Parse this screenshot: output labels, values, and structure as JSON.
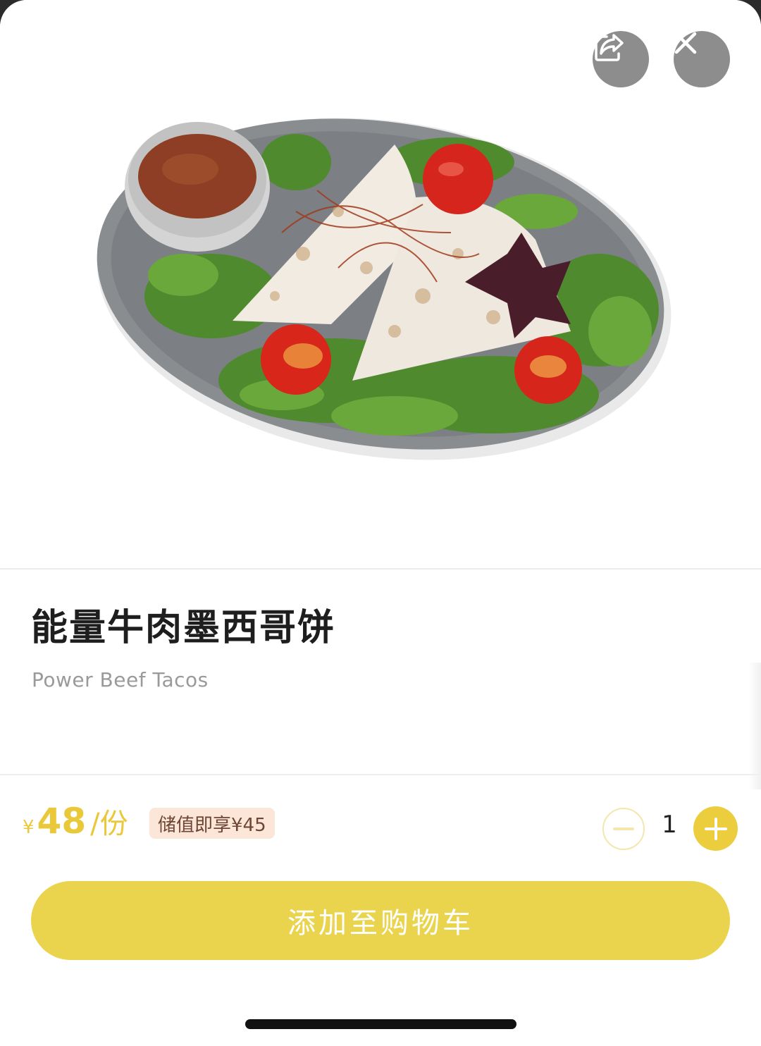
{
  "product": {
    "image_icon": "quesadilla-plate-photo",
    "name_cn": "能量牛肉墨西哥饼",
    "name_en": "Power Beef Tacos"
  },
  "header": {
    "share_icon": "share-icon",
    "close_icon": "close-icon"
  },
  "pricing": {
    "currency_symbol": "¥",
    "price": "48",
    "unit": "/份",
    "member_badge": "储值即享¥45",
    "price_color": "#e9c93a"
  },
  "quantity": {
    "minus_icon": "minus-icon",
    "value": "1",
    "plus_icon": "plus-icon"
  },
  "cart": {
    "add_label": "添加至购物车",
    "button_color": "#ebd44d"
  }
}
